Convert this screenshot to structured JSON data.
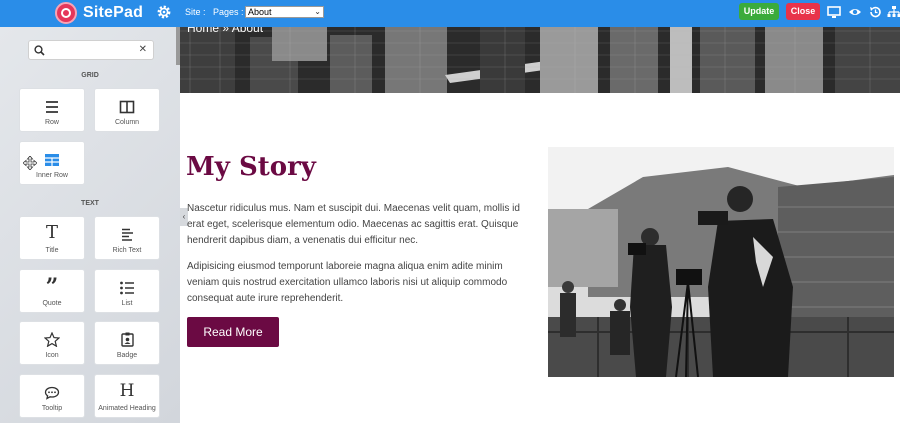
{
  "topbar": {
    "logo": "SitePad",
    "site_label": "Site :",
    "pages_label": "Pages :",
    "pages_selected": "About",
    "update_label": "Update",
    "close_label": "Close"
  },
  "sidebar": {
    "search_placeholder": "",
    "sections": [
      {
        "title": "GRID",
        "items": [
          {
            "label": "Row",
            "icon": "row-icon"
          },
          {
            "label": "Column",
            "icon": "column-icon"
          },
          {
            "label": "Inner Row",
            "icon": "inner-row-icon"
          }
        ]
      },
      {
        "title": "TEXT",
        "items": [
          {
            "label": "Title",
            "icon": "title-icon"
          },
          {
            "label": "Rich Text",
            "icon": "rich-text-icon"
          },
          {
            "label": "Quote",
            "icon": "quote-icon"
          },
          {
            "label": "List",
            "icon": "list-icon"
          },
          {
            "label": "Icon",
            "icon": "star-icon"
          },
          {
            "label": "Badge",
            "icon": "badge-icon"
          },
          {
            "label": "Tooltip",
            "icon": "tooltip-icon"
          },
          {
            "label": "Animated Heading",
            "icon": "animated-heading-icon"
          }
        ]
      }
    ]
  },
  "hero": {
    "breadcrumb": "Home » About"
  },
  "story": {
    "title": "My Story",
    "paragraph1": "Nascetur ridiculus mus. Nam et suscipit dui. Maecenas velit quam, mollis id erat eget, scelerisque elementum odio. Maecenas ac sagittis erat. Quisque hendrerit dapibus diam, a venenatis dui efficitur nec.",
    "paragraph2": "Adipisicing eiusmod temporunt laboreie magna aliqua enim adite minim veniam quis nostrud exercitation ullamco laboris nisi ut aliquip commodo consequat aute irure reprehenderit.",
    "button_label": "Read More"
  },
  "colors": {
    "topbar": "#2a8de8",
    "accent": "#6b0a43",
    "update": "#3bab3b",
    "close": "#e8334a"
  }
}
